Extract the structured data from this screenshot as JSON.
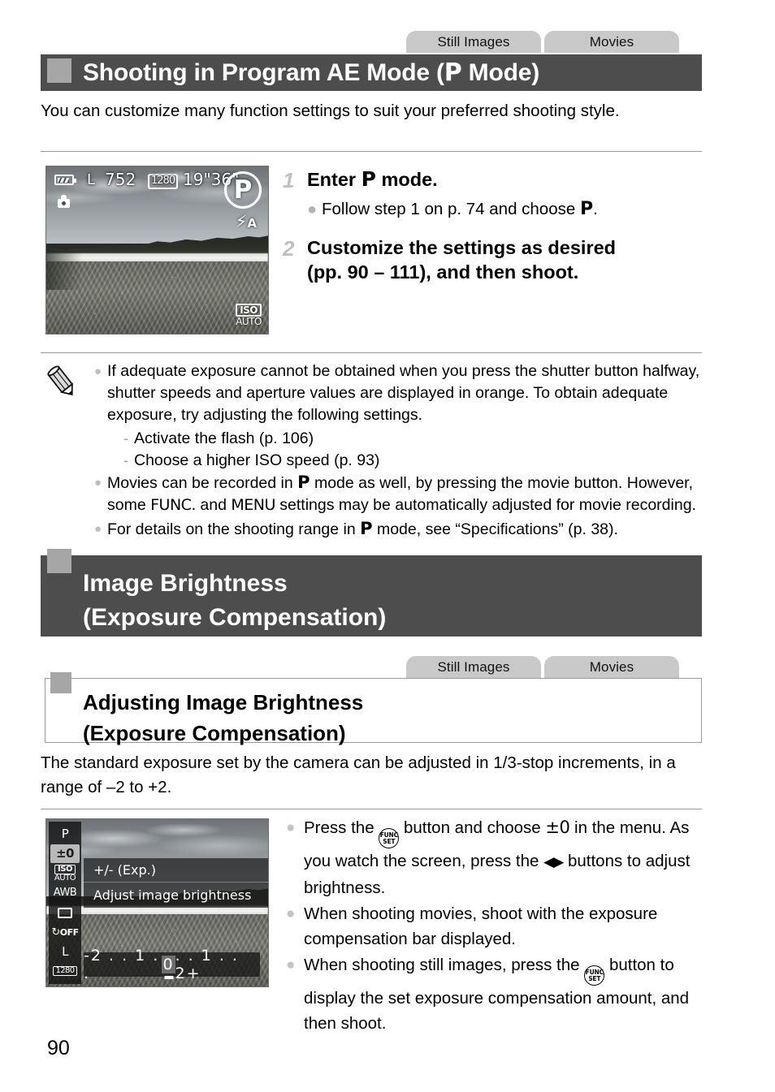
{
  "page": {
    "number": "90"
  },
  "section1": {
    "tabs": [
      {
        "label": "Still Images"
      },
      {
        "label": "Movies"
      }
    ],
    "title_prefix": "Shooting in Program AE Mode (",
    "title_symbol": "P",
    "title_suffix": " Mode)",
    "intro": "You can customize many function settings to suit your preferred shooting style.",
    "lcd": {
      "battery_icon": "battery-icon",
      "camera_icon": "camera-icon",
      "image_quality": "L",
      "shots_remaining": "752",
      "movie_quality": "1280",
      "movie_time": "19\"36\"",
      "mode_symbol": "P",
      "flash_mode": "A",
      "iso_label": "ISO",
      "iso_value": "AUTO"
    },
    "steps": [
      {
        "num": "1",
        "title_pre": "Enter ",
        "title_symbol": "P",
        "title_post": " mode.",
        "sub_pre": "Follow step 1 on p. 74 and choose ",
        "sub_symbol": "P",
        "sub_post": "."
      },
      {
        "num": "2",
        "title_line1": "Customize the settings as desired",
        "title_line2": "(pp. 90 – 111), and then shoot."
      }
    ],
    "note": {
      "icon": "pencil-icon",
      "items": [
        {
          "text": "If adequate exposure cannot be obtained when you press the shutter button halfway, shutter speeds and aperture values are displayed in orange. To obtain adequate exposure, try adjusting the following settings.",
          "subitems": [
            "Activate the flash (p. 106)",
            "Choose a higher ISO speed (p. 93)"
          ]
        },
        {
          "text_a": "Movies can be recorded in ",
          "sym_a": "P",
          "text_b": " mode as well, by pressing the movie button. However, some ",
          "sym_b": "FUNC.",
          "text_c": " and ",
          "sym_c": "MENU",
          "text_d": " settings may be automatically adjusted for movie recording."
        },
        {
          "text_a": "For details on the shooting range in ",
          "sym_a": "P",
          "text_b": " mode, see “Specifications” (p. 38)."
        }
      ]
    }
  },
  "section2": {
    "banner_line1": "Image Brightness",
    "banner_line2": "(Exposure Compensation)",
    "tabs": [
      {
        "label": "Still Images"
      },
      {
        "label": "Movies"
      }
    ],
    "sub_banner_line1": "Adjusting Image Brightness",
    "sub_banner_line2": "(Exposure Compensation)",
    "intro": "The standard exposure set by the camera can be adjusted in 1/3-stop increments, in a range of –2 to +2.",
    "lcd": {
      "func_items": [
        {
          "label": "P",
          "name": "func-item-mode"
        },
        {
          "label": "±0",
          "name": "func-item-exposure"
        },
        {
          "label_top": "ISO",
          "label_bottom": "AUTO",
          "name": "func-item-iso"
        },
        {
          "label": "AWB",
          "name": "func-item-white-balance"
        },
        {
          "label": "",
          "name": "func-item-drive-mode"
        },
        {
          "label": "OFF",
          "name": "func-item-self-timer"
        },
        {
          "label": "L",
          "name": "func-item-image-size"
        },
        {
          "label": "1280",
          "name": "func-item-movie-quality"
        }
      ],
      "tip_title": "+/- (Exp.)",
      "tip_desc": "Adjust image brightness",
      "exposure_scale_left": "-2 . . 1 . .",
      "exposure_scale_zero": "0",
      "exposure_scale_right": ". . 1 . . 2+"
    },
    "bullets": [
      {
        "t1": "Press the ",
        "icon1": "func-set-button-icon",
        "t2": " button and choose ",
        "sym": "±0",
        "t3": " in the menu. As you watch the screen, press the ",
        "arrows": "◀▶",
        "t4": " buttons to adjust brightness."
      },
      {
        "t1": "When shooting movies, shoot with the exposure compensation bar displayed."
      },
      {
        "t1": "When shooting still images, press the ",
        "icon1": "func-set-button-icon",
        "t2": " button to display the set exposure compensation amount, and then shoot."
      }
    ]
  },
  "icons": {
    "func_top": "FUNC",
    "func_bottom": "SET"
  }
}
